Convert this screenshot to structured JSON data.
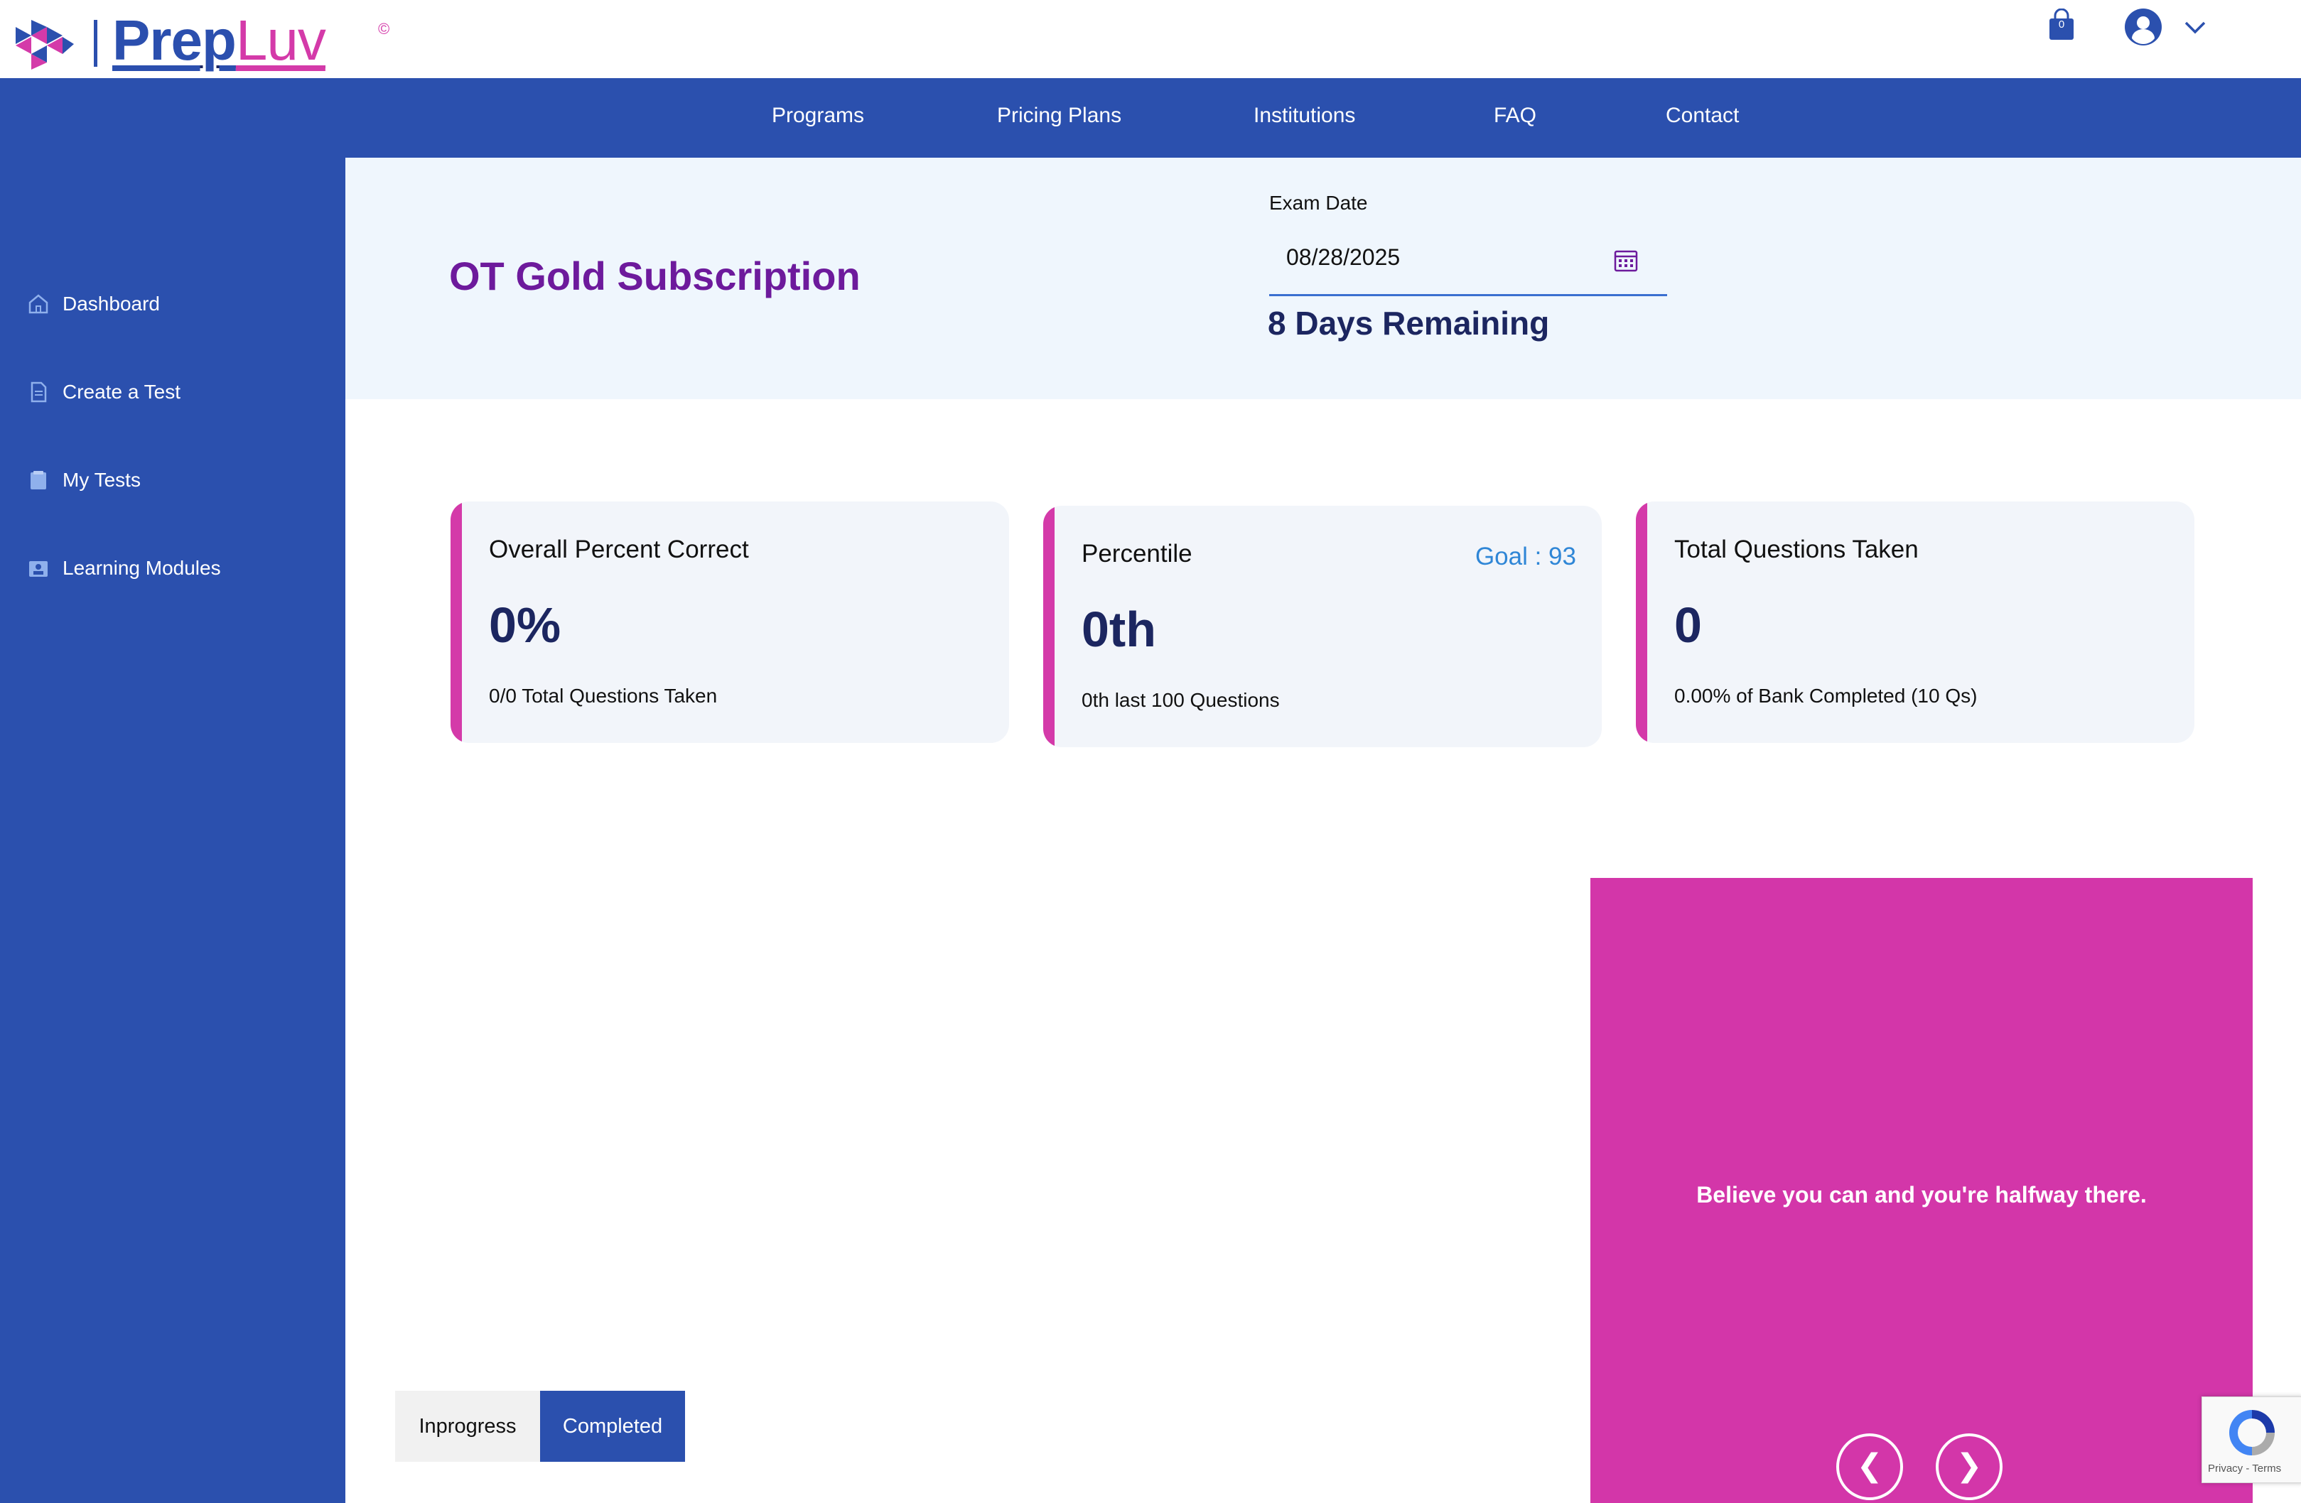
{
  "brand": {
    "prep": "Prep",
    "luv": "Luv",
    "copyright": "©"
  },
  "header": {
    "cart_count": "0"
  },
  "nav": [
    "Programs",
    "Pricing Plans",
    "Institutions",
    "FAQ",
    "Contact"
  ],
  "sidebar": {
    "items": [
      {
        "label": "Dashboard",
        "icon": "home-icon"
      },
      {
        "label": "Create a Test",
        "icon": "document-icon"
      },
      {
        "label": "My Tests",
        "icon": "tests-icon"
      },
      {
        "label": "Learning Modules",
        "icon": "modules-icon"
      }
    ]
  },
  "hero": {
    "title": "OT Gold Subscription",
    "exam_date_label": "Exam Date",
    "exam_date_value": "08/28/2025",
    "days_remaining": "8 Days Remaining"
  },
  "cards": [
    {
      "title": "Overall Percent Correct",
      "value": "0%",
      "sub": "0/0 Total Questions Taken"
    },
    {
      "title": "Percentile",
      "value": "0th",
      "sub": "0th last 100 Questions",
      "goal": "Goal : 93"
    },
    {
      "title": "Total Questions Taken",
      "value": "0",
      "sub": "0.00% of Bank Completed (10 Qs)"
    }
  ],
  "quote": {
    "text": "Believe you can and you're halfway there.",
    "prev": "❮",
    "next": "❯"
  },
  "tabs": {
    "inprogress": "Inprogress",
    "completed": "Completed"
  },
  "recaptcha": {
    "text": "Privacy - Terms"
  },
  "colors": {
    "brand_blue": "#2b50ae",
    "brand_pink": "#d43aa9",
    "title_purple": "#6d1a9c",
    "goal_blue": "#2f86d6"
  }
}
